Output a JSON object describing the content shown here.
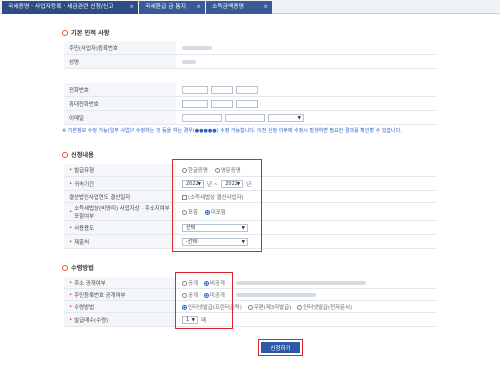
{
  "tabs": [
    {
      "label": "국세증명 · 사업자등록 · 세금관련 신청/신고",
      "close": "×"
    },
    {
      "label": "국세환급 금 통지",
      "close": "×"
    },
    {
      "label": "소득금액증명",
      "close": "×"
    }
  ],
  "basic": {
    "title": "기본 인적 사항",
    "fields": [
      "주민(사업자)등록번호",
      "성명",
      "전화번호",
      "휴대전화번호",
      "이메일"
    ]
  },
  "notice": "※ 기본정보 수정 가능(일부 사업)? 수정하는 것 등을 하는 경우(●●●●●) 수정 가능합니다. 이전 신청 이후에 수정시 발생하면 필요한 결과를 확인할 수 있습니다.",
  "apply": {
    "title": "신청내용",
    "rows": [
      {
        "label": "발급유형",
        "required": true
      },
      {
        "label": "귀속기간",
        "required": true
      },
      {
        "label": "결산법인사업연도 결산일자",
        "required": false
      },
      {
        "label": "소득세법상(비영리) 사업자상 · 주소지여부 포함여부",
        "required": true
      },
      {
        "label": "사용용도",
        "required": true
      },
      {
        "label": "제출처",
        "required": true
      }
    ],
    "issue_opts": [
      "한글증명",
      "영문증명"
    ],
    "year_from": "2022",
    "year_to": "2022",
    "year_sep": "년 ~",
    "year_unit": "년",
    "settle_check": "(소득세법상 결산사업자)",
    "addr_opts": [
      "포함",
      "미포함"
    ],
    "purpose_value": "선택",
    "submit_value": "-선택-"
  },
  "receive": {
    "title": "수령방법",
    "rows": [
      {
        "label": "주소 공개여부",
        "required": true
      },
      {
        "label": "주민등록번호 공개여부",
        "required": true
      },
      {
        "label": "수령방법",
        "required": true
      },
      {
        "label": "발급매수(수령)",
        "required": true
      }
    ],
    "addr_opts": [
      "공개",
      "비공개"
    ],
    "rrn_opts": [
      "공개",
      "미공개"
    ],
    "method_opts": [
      "인터넷발급(프린터출력)",
      "우편(제3자발급)",
      "인터넷발급(전자문서)"
    ],
    "copies_value": "1",
    "copies_unit": "매"
  },
  "submit_button": "신청하기"
}
